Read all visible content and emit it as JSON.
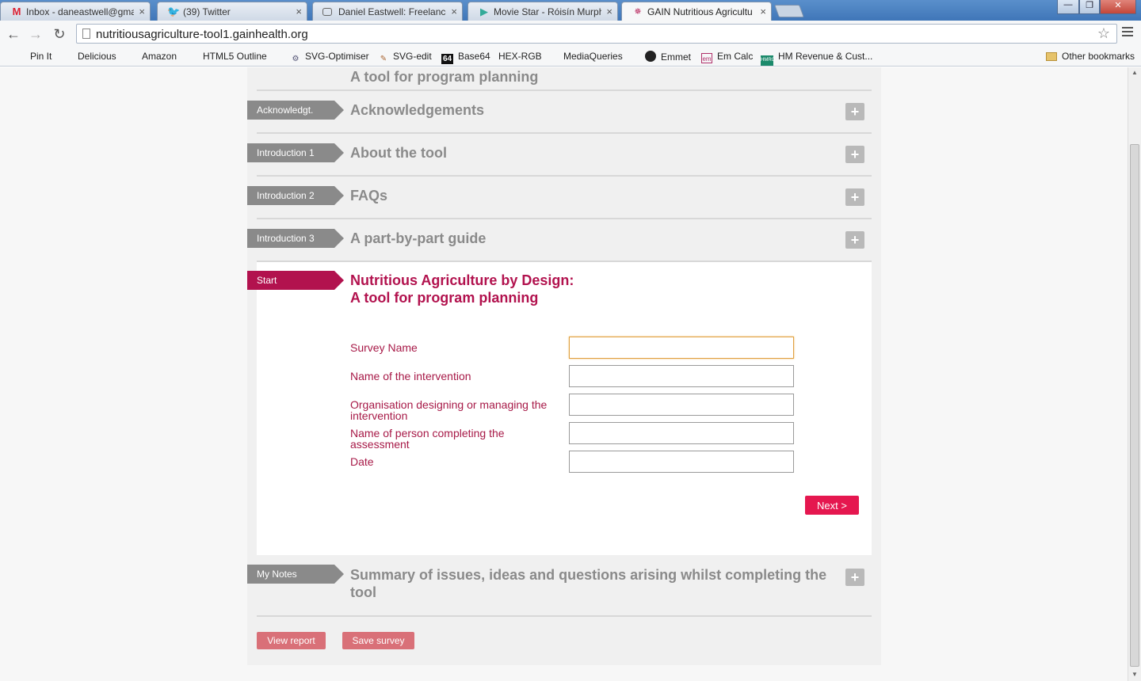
{
  "browser": {
    "tabs": [
      {
        "title": "Inbox - daneastwell@gma",
        "icon": "gmail-icon"
      },
      {
        "title": "(39) Twitter",
        "icon": "twitter-icon"
      },
      {
        "title": "Daniel Eastwell: Freelance",
        "icon": "page-icon"
      },
      {
        "title": "Movie Star - Róisín Murph",
        "icon": "play-icon"
      },
      {
        "title": "GAIN Nutritious Agricultu",
        "icon": "gain-icon"
      }
    ],
    "tab_close_glyph": "×",
    "url": "nutritiousagriculture-tool1.gainhealth.org",
    "bookmarks": [
      {
        "label": "Pin It",
        "icon": "page-icon"
      },
      {
        "label": "Delicious",
        "icon": "page-icon"
      },
      {
        "label": "Amazon",
        "icon": "page-icon"
      },
      {
        "label": "HTML5 Outline",
        "icon": "page-icon"
      },
      {
        "label": "SVG-Optimiser",
        "icon": "svg-optimiser-icon"
      },
      {
        "label": "SVG-edit",
        "icon": "svg-edit-icon"
      },
      {
        "label": "Base64",
        "icon": "base64-icon",
        "badge": "64"
      },
      {
        "label": "HEX-RGB",
        "icon": "page-icon"
      },
      {
        "label": "MediaQueries",
        "icon": "page-icon"
      },
      {
        "label": "Emmet",
        "icon": "emmet-icon"
      },
      {
        "label": "Em Calc",
        "icon": "emcalc-icon",
        "badge": "em"
      },
      {
        "label": "HM Revenue & Cust...",
        "icon": "hmrc-icon",
        "badge": "HMRC"
      }
    ],
    "other_bookmarks": "Other bookmarks"
  },
  "page": {
    "partial_title": "A tool for program planning",
    "sections": [
      {
        "tag": "Acknowledgt.",
        "title": "Acknowledgements"
      },
      {
        "tag": "Introduction 1",
        "title": "About the tool"
      },
      {
        "tag": "Introduction 2",
        "title": "FAQs"
      },
      {
        "tag": "Introduction 3",
        "title": "A part-by-part guide"
      }
    ],
    "expand_glyph": "+",
    "active": {
      "tag": "Start",
      "title_line1": "Nutritious Agriculture by Design:",
      "title_line2": "A tool for program planning",
      "fields": [
        {
          "label": "Survey Name",
          "value": ""
        },
        {
          "label": "Name of the intervention",
          "value": ""
        },
        {
          "label": "Organisation designing or managing the intervention",
          "value": ""
        },
        {
          "label": "Name of person completing the assessment",
          "value": ""
        },
        {
          "label": "Date",
          "value": ""
        }
      ],
      "next_label": "Next >"
    },
    "notes": {
      "tag": "My Notes",
      "title": "Summary of issues, ideas and questions arising whilst completing the tool"
    },
    "actions": {
      "view_report": "View report",
      "save_survey": "Save survey"
    }
  },
  "colors": {
    "accent": "#b2124e",
    "button": "#e5174f",
    "action": "#d97078",
    "tag_grey": "#8a8a8a"
  }
}
